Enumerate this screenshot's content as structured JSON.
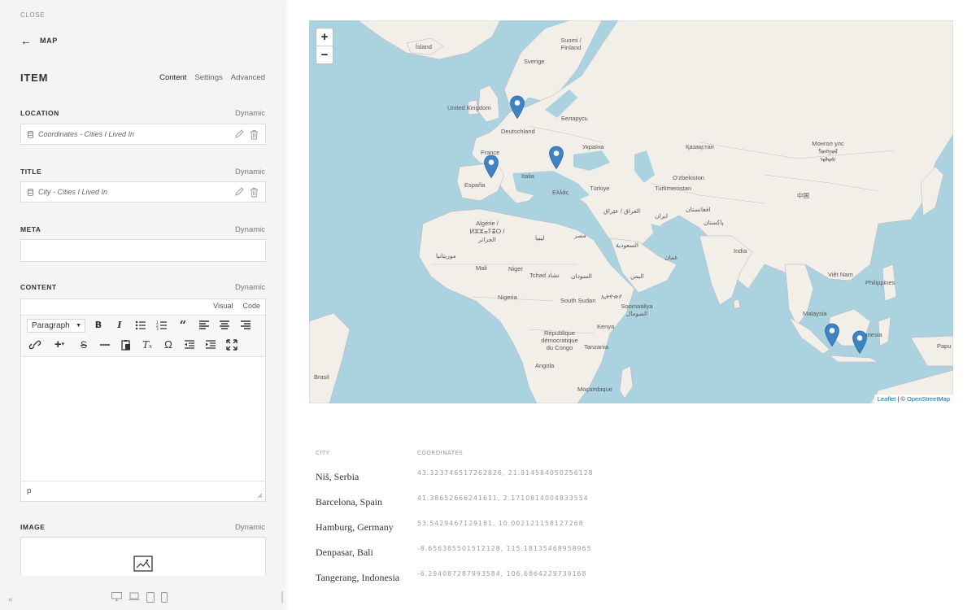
{
  "sidebar": {
    "close_label": "CLOSE",
    "back_label": "MAP",
    "item_title": "ITEM",
    "tabs": [
      {
        "label": "Content",
        "active": true
      },
      {
        "label": "Settings",
        "active": false
      },
      {
        "label": "Advanced",
        "active": false
      }
    ],
    "fields": {
      "location": {
        "label": "LOCATION",
        "dynamic": "Dynamic",
        "value": "Coordinates - Cities I Lived In"
      },
      "title": {
        "label": "TITLE",
        "dynamic": "Dynamic",
        "value": "City - Cities I Lived In"
      },
      "meta": {
        "label": "META",
        "dynamic": "Dynamic",
        "value": ""
      },
      "content": {
        "label": "CONTENT",
        "dynamic": "Dynamic"
      },
      "image": {
        "label": "IMAGE",
        "dynamic": "Dynamic"
      }
    },
    "editor": {
      "tabs": [
        "Visual",
        "Code"
      ],
      "format_select": "Paragraph",
      "status_path": "p",
      "toolbar_row1": [
        "bold-icon",
        "italic-icon",
        "bullet-list-icon",
        "numbered-list-icon",
        "blockquote-icon",
        "align-left-icon",
        "align-center-icon",
        "align-right-icon"
      ],
      "toolbar_row2": [
        "link-icon",
        "insert-icon",
        "strikethrough-icon",
        "horizontal-rule-icon",
        "paste-text-icon",
        "clear-formatting-icon",
        "special-character-icon",
        "outdent-icon",
        "indent-icon",
        "fullscreen-icon"
      ]
    },
    "footer": {
      "collapse_label": "«",
      "devices": [
        "desktop-icon",
        "laptop-icon",
        "tablet-icon",
        "mobile-icon"
      ]
    }
  },
  "map": {
    "zoom_in": "+",
    "zoom_out": "−",
    "attribution_leaflet": "Leaflet",
    "attribution_sep": " | © ",
    "attribution_osm": "OpenStreetMap",
    "labels": [
      "Ísland",
      "Suomi / Finland",
      "Sverige",
      "United Kingdom",
      "Беларусь",
      "Deutschland",
      "Україна",
      "France",
      "Қазақстан",
      "Монгол улс ᠮᠣᠩᠭᠣᠯ ᠤᠯᠤᠰ",
      "España",
      "Italia",
      "Ελλάς",
      "Türkiye",
      "O'zbekiston",
      "Turkmenistan",
      "افغانستان",
      "中国",
      "Algérie / ⵍⵣⵣⴰⵢⴻⵔ / الجزائر",
      "ليبيا",
      "مصر",
      "العراق / عێراق",
      "ایران",
      "پاکستان",
      "موريتانيا",
      "السعودية",
      "Mali",
      "Niger",
      "Tchad تشاد",
      "السودان",
      "عمان",
      "India",
      "Việt Nam",
      "Philippines",
      "Nigeria",
      "South Sudan",
      "ኢትዮጵያ",
      "Soomaaliya الصومال",
      "اليمن",
      "Malaysia",
      "République démocratique du Congo",
      "Kenya",
      "Indonesia",
      "Tanzania",
      "Angola",
      "Moçambique",
      "Brasil",
      "Papu"
    ],
    "marker_color": "#3f83c4",
    "markers": [
      "Niš, Serbia",
      "Barcelona, Spain",
      "Hamburg, Germany",
      "Denpasar, Bali",
      "Tangerang, Indonesia"
    ]
  },
  "table": {
    "headers": {
      "city": "CITY",
      "coordinates": "COORDINATES"
    },
    "rows": [
      {
        "city": "Niš, Serbia",
        "coordinates": "43.323746517262826, 21.914584050256128"
      },
      {
        "city": "Barcelona, Spain",
        "coordinates": "41.38652666241611, 2.1710814004833554"
      },
      {
        "city": "Hamburg, Germany",
        "coordinates": "53.5429467129181, 10.002121158127268"
      },
      {
        "city": "Denpasar, Bali",
        "coordinates": "-8.656385501512128, 115.18135468958965"
      },
      {
        "city": "Tangerang, Indonesia",
        "coordinates": "-6.294087287993584, 106.6864229739168"
      }
    ]
  }
}
